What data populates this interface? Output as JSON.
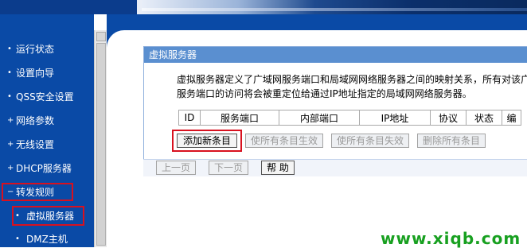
{
  "sidebar": {
    "items": [
      {
        "label": "运行状态",
        "bullet": "•"
      },
      {
        "label": "设置向导",
        "bullet": "•"
      },
      {
        "label": "QSS安全设置",
        "bullet": "•"
      },
      {
        "label": "网络参数",
        "bullet": "+"
      },
      {
        "label": "无线设置",
        "bullet": "+"
      },
      {
        "label": "DHCP服务器",
        "bullet": "+"
      },
      {
        "label": "转发规则",
        "bullet": "−"
      },
      {
        "label": "虚拟服务器",
        "bullet": "•"
      },
      {
        "label": "DMZ主机",
        "bullet": "•"
      }
    ]
  },
  "panel": {
    "title": "虚拟服务器",
    "description_line1": "虚拟服务器定义了广域网服务端口和局域网网络服务器之间的映射关系，所有对该广",
    "description_line2": "服务端口的访问将会被重定位给通过IP地址指定的局域网网络服务器。"
  },
  "table": {
    "headers": [
      "ID",
      "服务端口",
      "内部端口",
      "IP地址",
      "协议",
      "状态",
      "编"
    ]
  },
  "actions": {
    "add": "添加新条目",
    "enable_all": "使所有条目生效",
    "disable_all": "使所有条目失效",
    "delete_all": "删除所有条目"
  },
  "footer": {
    "prev": "上一页",
    "next": "下一页",
    "help": "帮 助"
  },
  "watermark": "www.xiqb.com",
  "colors": {
    "sidebar": "#0a4aa6",
    "panel_title": "#5a8fd0",
    "highlight": "#d8111f",
    "watermark": "#18a020"
  }
}
